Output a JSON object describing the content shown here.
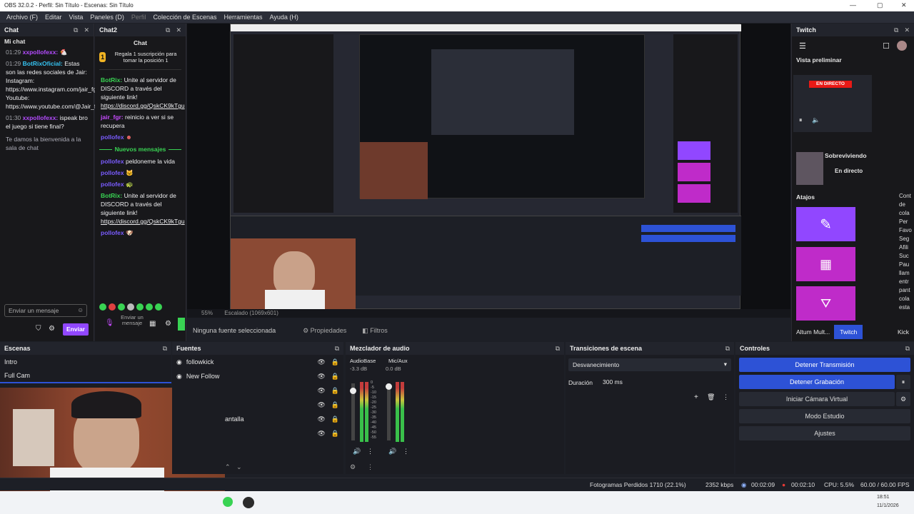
{
  "window": {
    "title": "OBS 32.0.2 - Perfil: Sin Título - Escenas: Sin Título"
  },
  "menu": [
    "Archivo (F)",
    "Editar",
    "Vista",
    "Paneles (D)",
    "Perfil",
    "Colección de Escenas",
    "Herramientas",
    "Ayuda (H)"
  ],
  "chat1": {
    "dock_title": "Chat",
    "header": "Mi chat",
    "messages": [
      {
        "user": "xxpollofexx:",
        "text": ""
      },
      {
        "user": "BotRixOficial:",
        "text": "Estas son las redes sociales de Jair: Instagram: https://www.instagram.com/jair_fgr/ Youtube: https://www.youtube.com/@Jair_fgr"
      },
      {
        "user": "xxpollofexx:",
        "text": "ispeak bro el juego si tiene final?"
      }
    ],
    "welcome": "Te damos la bienvenida a la sala de chat",
    "input_placeholder": "Enviar un mensaje",
    "send_label": "Enviar"
  },
  "chat2": {
    "dock_title": "Chat2",
    "header": "Chat",
    "sub_title": "Regala 1 suscripción para tomar la posición 1",
    "msg1_user": "BotRix:",
    "msg1_text": "Unite al servidor de DISCORD a través del siguiente link!",
    "msg1_link": "https://discord.gg/QskCK9kTgu",
    "msg2_user": "jair_fgr:",
    "msg2_text": "reinicio a ver si se recupera",
    "msg3_user": "pollofex",
    "new_messages": "Nuevos mensajes",
    "msg4_user": "pollofex",
    "msg4_text": "peldoneme la vida",
    "msg5_user": "pollofex",
    "msg6_user": "pollofex",
    "msg7_user": "BotRix:",
    "msg7_text": "Unite al servidor de DISCORD a través del siguiente link!",
    "msg7_link": "https://discord.gg/QskCK9kTgu",
    "msg8_user": "pollofex",
    "input_placeholder": "Enviar un mensaje"
  },
  "preview_bar": {
    "zoom": "55%",
    "scale": "Escalado (1069x601)"
  },
  "source_toolbar": {
    "no_source": "Ninguna fuente seleccionada",
    "props": "Propiedades",
    "filters": "Filtros"
  },
  "twitch": {
    "dock_title": "Twitch",
    "preview_label": "Vista preliminar",
    "live": "EN DIRECTO",
    "stream_title": "Sobreviviendo",
    "stream_sub": "En directo",
    "shortcuts": "Atajos",
    "tabs": [
      "Altum Mult...",
      "Twitch",
      "Kick"
    ],
    "side_text": [
      "Cont",
      "de",
      "cola",
      "Per",
      "Favo",
      "Seg",
      "Afili",
      "Suc",
      "Pau",
      "llam",
      "entr",
      "pant",
      "cola",
      "esta"
    ]
  },
  "scenes": {
    "title": "Escenas",
    "items": [
      "Intro",
      "Full Cam"
    ]
  },
  "sources": {
    "title": "Fuentes",
    "items": [
      "followkick",
      "New Follow",
      "",
      "",
      "antalla",
      ""
    ]
  },
  "mixer": {
    "title": "Mezclador de audio",
    "channels": [
      {
        "name": "AudioBase",
        "db": "-3.3 dB"
      },
      {
        "name": "Mic/Aux",
        "db": "0.0 dB"
      }
    ],
    "ticks": [
      "0",
      "-5",
      "-10",
      "-15",
      "-20",
      "-25",
      "-30",
      "-35",
      "-40",
      "-45",
      "-50",
      "-55",
      "-60"
    ]
  },
  "transitions": {
    "title": "Transiciones de escena",
    "selected": "Desvanecimiento",
    "duration_label": "Duración",
    "duration_value": "300 ms"
  },
  "controls": {
    "title": "Controles",
    "buttons": [
      "Detener Transmisión",
      "Detener Grabación",
      "Iniciar Cámara Virtual",
      "Modo Estudio",
      "Ajustes"
    ]
  },
  "status": {
    "dropped": "Fotogramas Perdidos 1710 (22.1%)",
    "bitrate": "2352 kbps",
    "stream_time": "00:02:09",
    "rec_time": "00:02:10",
    "cpu": "CPU: 5.5%",
    "fps": "60.00 / 60.00 FPS"
  },
  "taskbar": {
    "time": "18:51",
    "date": "11/1/2026"
  },
  "colors": {
    "accent": "#2d52d6",
    "twitch_purple": "#9147ff",
    "live_red": "#e91916",
    "magenta": "#bf2bc9"
  }
}
